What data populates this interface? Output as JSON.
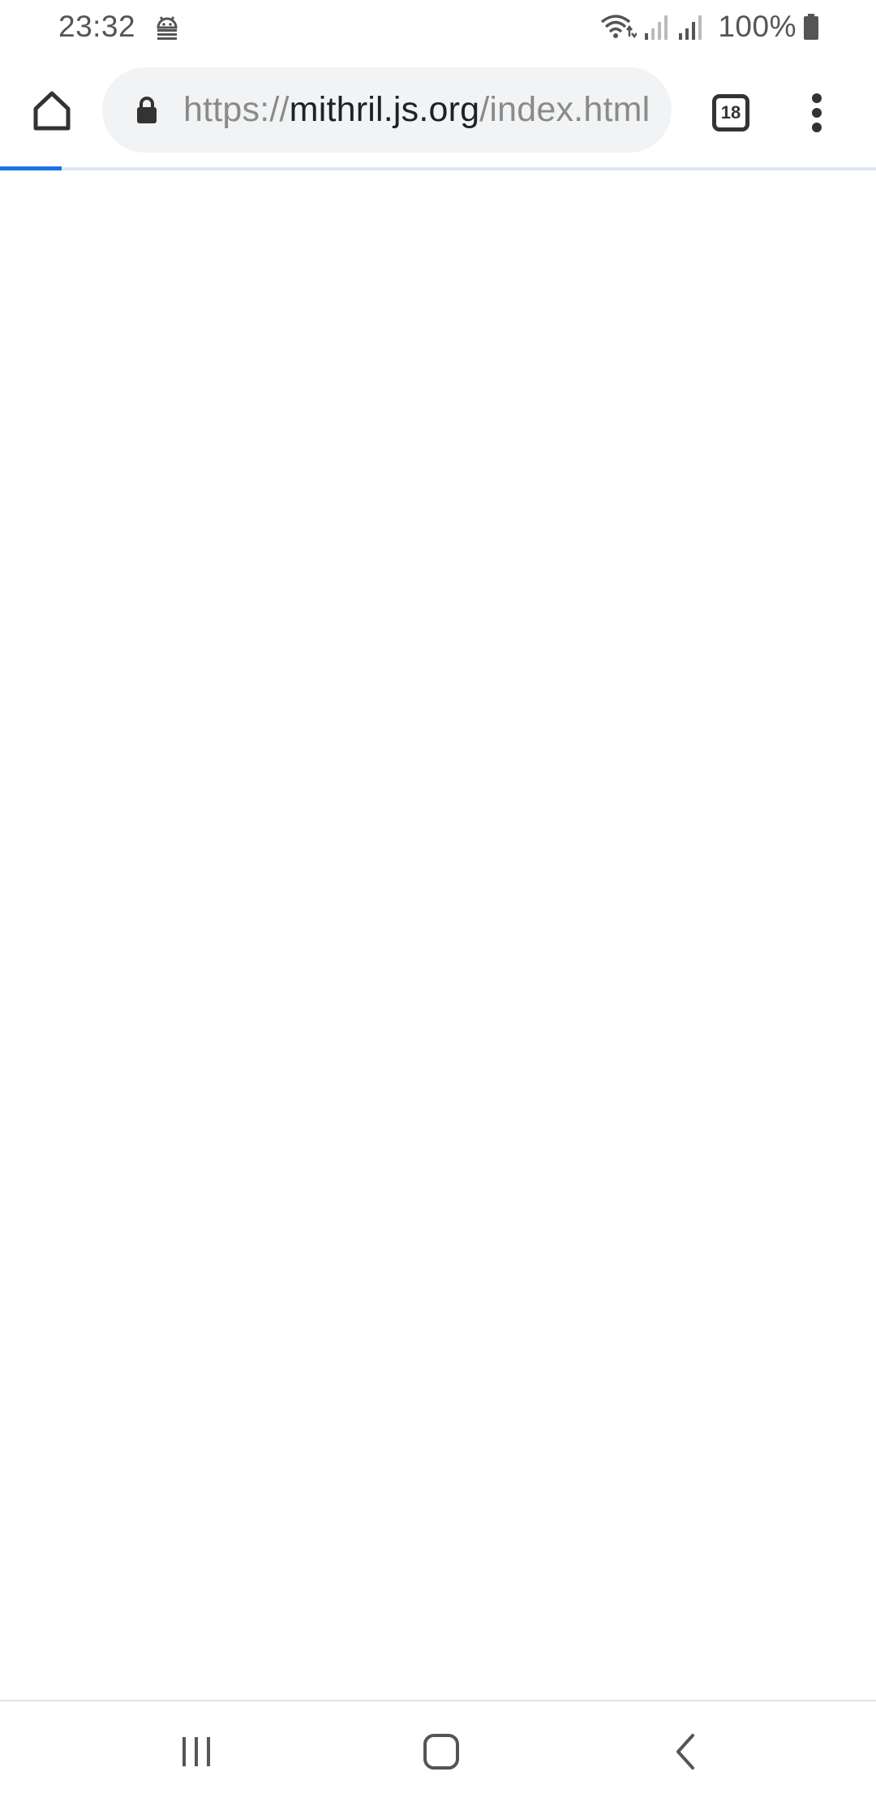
{
  "status_bar": {
    "time": "23:32",
    "battery_percent": "100%",
    "icons": [
      "android-debug-icon",
      "wifi-icon",
      "signal-icon",
      "signal-icon",
      "battery-icon"
    ]
  },
  "toolbar": {
    "url_scheme": "https://",
    "url_domain": "mithril.js.org",
    "url_path": "/index.html",
    "tab_count": "18",
    "icons": [
      "home-icon",
      "lock-icon",
      "tab-switcher-icon",
      "more-vert-icon"
    ]
  },
  "page_load": {
    "progress": 0.07
  },
  "nav_bar": {
    "icons": [
      "recents-icon",
      "home-icon",
      "back-icon"
    ]
  },
  "colors": {
    "accent": "#1a73e8",
    "url_bar_bg": "#f1f3f4",
    "icon": "#333333"
  }
}
